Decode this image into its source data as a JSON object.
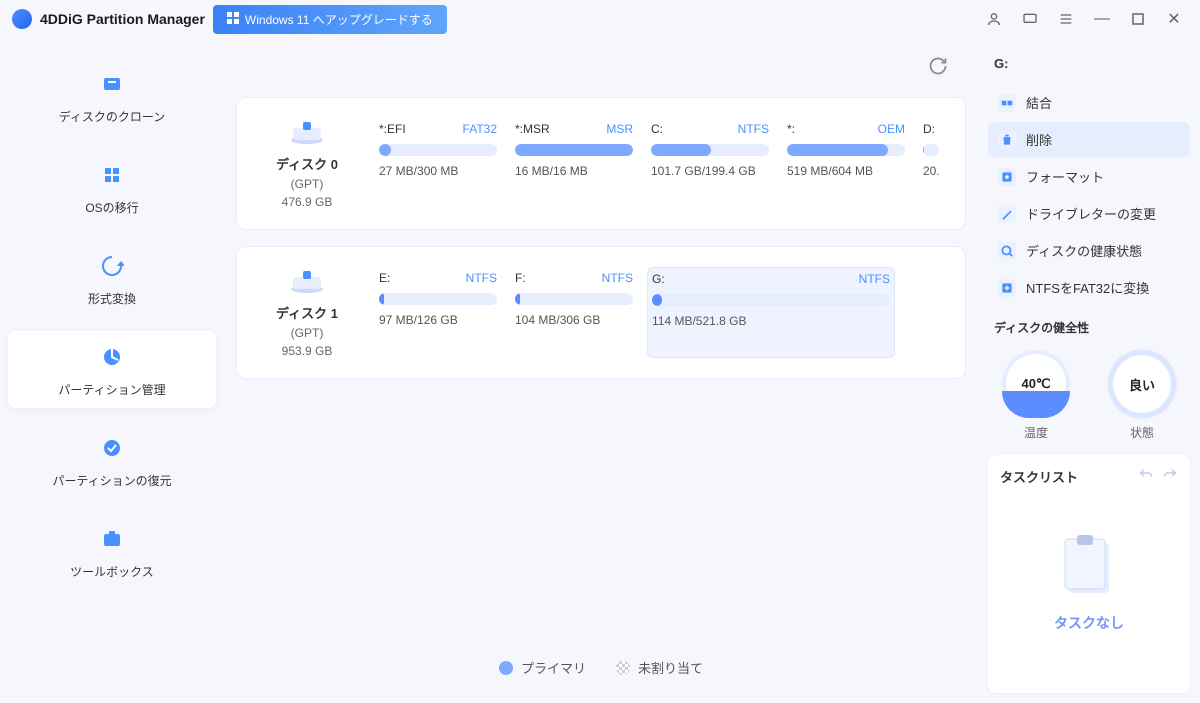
{
  "titlebar": {
    "app": "4DDiG Partition Manager",
    "upgrade": "Windows 11 へアップグレードする"
  },
  "sidebar": {
    "items": [
      {
        "label": "ディスクのクローン"
      },
      {
        "label": "OSの移行"
      },
      {
        "label": "形式変換"
      },
      {
        "label": "パーティション管理"
      },
      {
        "label": "パーティションの復元"
      },
      {
        "label": "ツールボックス"
      }
    ]
  },
  "disks": [
    {
      "name": "ディスク 0",
      "type": "(GPT)",
      "size": "476.9 GB",
      "partitions": [
        {
          "letter": "*:EFI",
          "fs": "FAT32",
          "usage": "27 MB/300 MB",
          "fill": 10
        },
        {
          "letter": "*:MSR",
          "fs": "MSR",
          "usage": "16 MB/16 MB",
          "fill": 100
        },
        {
          "letter": "C:",
          "fs": "NTFS",
          "usage": "101.7 GB/199.4 GB",
          "fill": 51
        },
        {
          "letter": "*:",
          "fs": "OEM",
          "usage": "519 MB/604 MB",
          "fill": 86
        },
        {
          "letter": "D:",
          "fs": "",
          "usage": "20.",
          "fill": 8,
          "cut": true
        }
      ]
    },
    {
      "name": "ディスク 1",
      "type": "(GPT)",
      "size": "953.9 GB",
      "partitions": [
        {
          "letter": "E:",
          "fs": "NTFS",
          "usage": "97 MB/126 GB",
          "fill": 2
        },
        {
          "letter": "F:",
          "fs": "NTFS",
          "usage": "104 MB/306 GB",
          "fill": 2
        },
        {
          "letter": "G:",
          "fs": "NTFS",
          "usage": "114 MB/521.8 GB",
          "fill": 2,
          "selected": true,
          "wide": true
        }
      ]
    }
  ],
  "legend": {
    "primary": "プライマリ",
    "unallocated": "未割り当て"
  },
  "rightbar": {
    "selected_drive": "G:",
    "actions": [
      {
        "label": "結合"
      },
      {
        "label": "削除",
        "selected": true
      },
      {
        "label": "フォーマット"
      },
      {
        "label": "ドライブレターの変更"
      },
      {
        "label": "ディスクの健康状態"
      },
      {
        "label": "NTFSをFAT32に変換"
      }
    ],
    "health_section": "ディスクの健全性",
    "temp_value": "40℃",
    "temp_label": "温度",
    "state_value": "良い",
    "state_label": "状態",
    "tasklist_title": "タスクリスト",
    "no_task": "タスクなし"
  }
}
